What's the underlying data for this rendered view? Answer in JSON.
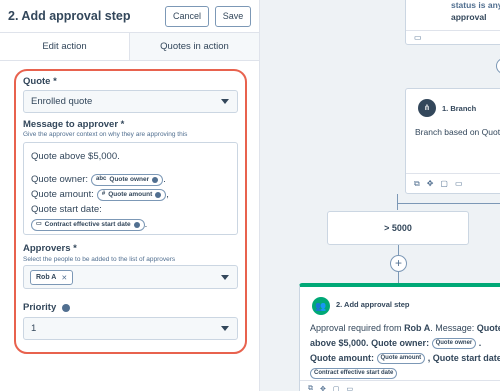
{
  "header": {
    "title": "2. Add approval step",
    "cancel_label": "Cancel",
    "save_label": "Save"
  },
  "tabs": [
    {
      "label": "Edit action",
      "active": true
    },
    {
      "label": "Quotes in action",
      "active": false
    }
  ],
  "form": {
    "quote": {
      "label": "Quote *",
      "value": "Enrolled quote"
    },
    "message": {
      "label": "Message to approver *",
      "help": "Give the approver context on why they are approving this",
      "line1": "Quote above $5,000.",
      "owner_prefix": "Quote owner:",
      "owner_token": "Quote owner",
      "amount_prefix": "Quote amount:",
      "amount_token": "Quote amount",
      "start_prefix": "Quote start date:",
      "start_token": "Contract effective start date",
      "comma": ",",
      "period": "."
    },
    "approvers": {
      "label": "Approvers *",
      "help": "Select the people to be added to the list of approvers",
      "chips": [
        "Rob A"
      ]
    },
    "priority": {
      "label": "Priority",
      "value": "1"
    }
  },
  "canvas": {
    "top_card": {
      "line1": "status is any of",
      "line2": "approval"
    },
    "branch_card": {
      "title": "1. Branch",
      "body": "Branch based on Quote"
    },
    "condition_card": {
      "label": "> 5000"
    },
    "approval_card": {
      "title": "2. Add approval step",
      "body_prefix": "Approval required from",
      "approver": "Rob A",
      "message_label": "Message:",
      "message_text": "Quote above $5,000.",
      "owner_label": "Quote owner:",
      "owner_token": "Quote owner",
      "amount_label": ". Quote amount:",
      "amount_token": "Quote amount",
      "start_label": ", Quote start date:",
      "start_token": "Contract effective start date"
    }
  },
  "colors": {
    "accent_outline": "#e8624e",
    "approval_green": "#00a876",
    "text": "#33475b"
  }
}
